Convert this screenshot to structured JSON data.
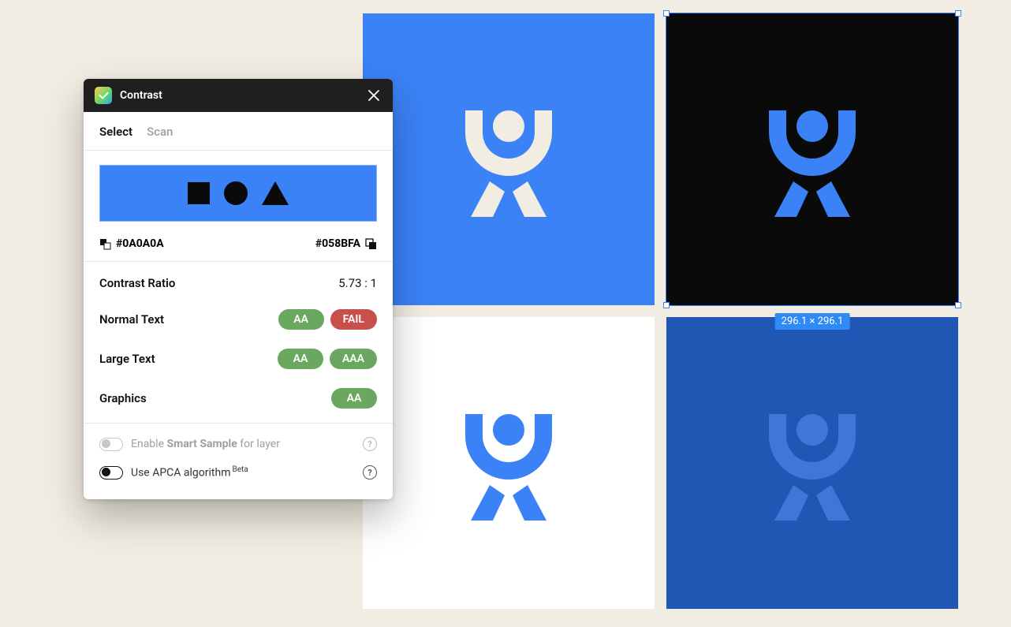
{
  "panel": {
    "title": "Contrast",
    "tabs": {
      "select": "Select",
      "scan": "Scan"
    },
    "colors": {
      "fg": "#0A0A0A",
      "bg": "#058BFA"
    },
    "results": {
      "ratio_label": "Contrast Ratio",
      "ratio_value": "5.73 : 1",
      "normal_label": "Normal Text",
      "normal_aa": "AA",
      "normal_aaa": "FAIL",
      "large_label": "Large Text",
      "large_aa": "AA",
      "large_aaa": "AAA",
      "graphics_label": "Graphics",
      "graphics_aa": "AA"
    },
    "settings": {
      "smart_prefix": "Enable ",
      "smart_strong": "Smart Sample",
      "smart_suffix": " for layer",
      "apca_label": "Use APCA algorithm",
      "apca_badge": "Beta"
    }
  },
  "selection": {
    "dimensions": "296.1 × 296.1"
  },
  "tiles": {
    "t1": {
      "bg": "#3b82f6",
      "fg": "#f2ede3"
    },
    "t2": {
      "bg": "#0a0a0a",
      "fg": "#3b82f6"
    },
    "t3": {
      "bg": "#ffffff",
      "fg": "#3b82f6"
    },
    "t4": {
      "bg": "#2057b5",
      "fg": "#3f77d6"
    }
  }
}
